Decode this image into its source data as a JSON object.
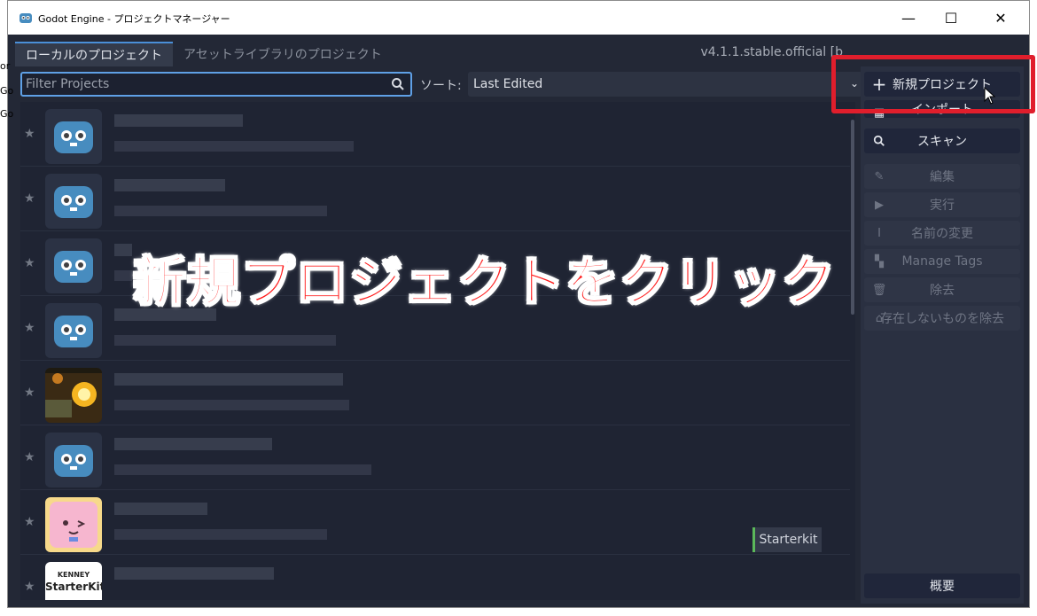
{
  "window": {
    "title": "Godot Engine - プロジェクトマネージャー",
    "controls": {
      "minimize": "—",
      "maximize": "☐",
      "close": "✕"
    }
  },
  "peek": [
    "or",
    "Go",
    "Go"
  ],
  "tabs": [
    {
      "label": "ローカルのプロジェクト",
      "active": true
    },
    {
      "label": "アセットライブラリのプロジェクト",
      "active": false
    }
  ],
  "version": "v4.1.1.stable.official [b",
  "filter": {
    "placeholder": "Filter Projects"
  },
  "sort": {
    "label": "ソート:",
    "value": "Last Edited"
  },
  "projects": [
    {
      "thumb": "godot-icon",
      "badge": ""
    },
    {
      "thumb": "godot-icon",
      "badge": ""
    },
    {
      "thumb": "godot-icon",
      "badge": ""
    },
    {
      "thumb": "godot-icon",
      "badge": ""
    },
    {
      "thumb": "game-screenshot",
      "badge": ""
    },
    {
      "thumb": "godot-icon",
      "badge": ""
    },
    {
      "thumb": "pink-character",
      "badge": ""
    },
    {
      "thumb": "starterkit-logo",
      "badge": "Starterkit",
      "logo_text": [
        "KENNEY",
        "StarterKit"
      ]
    }
  ],
  "sidebar": {
    "new_project": "新規プロジェクト",
    "import": "インポート",
    "scan": "スキャン",
    "edit": "編集",
    "run": "実行",
    "rename": "名前の変更",
    "manage_tags": "Manage Tags",
    "remove": "除去",
    "remove_missing": "存在しないものを除去",
    "about": "概要"
  },
  "annotation": {
    "text": "新規プロジェクトをクリック",
    "color": "#ff1a1a"
  },
  "colors": {
    "background": "#232836",
    "accent": "#5fa0e6",
    "highlight": "#e01e2c"
  }
}
